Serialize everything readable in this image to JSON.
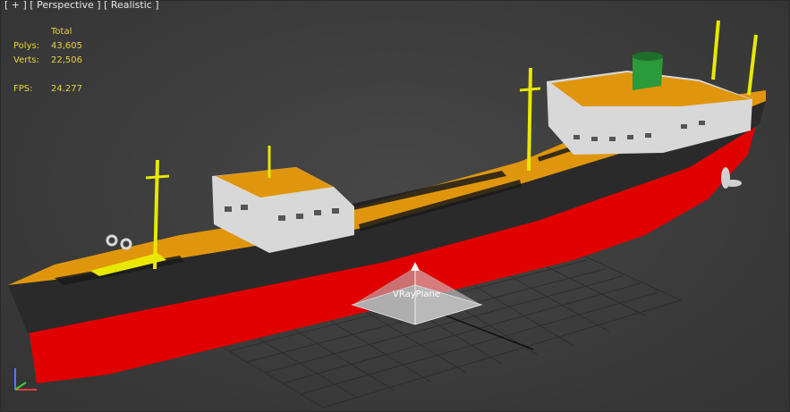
{
  "viewport": {
    "label_plus": "[ + ]",
    "label_view": "[ Perspective ]",
    "label_shading": "[ Realistic ]"
  },
  "stats": {
    "header": "Total",
    "polys_label": "Polys:",
    "polys_value": "43,605",
    "verts_label": "Verts:",
    "verts_value": "22,506",
    "fps_label": "FPS:",
    "fps_value": "24.277"
  },
  "scene": {
    "plane_name": "VRayPlane"
  },
  "colors": {
    "hull_red": "#e00000",
    "hull_black": "#262626",
    "deck_orange": "#e0960c",
    "superstructure_white": "#d8d8d8",
    "mast_yellow": "#e8e800",
    "funnel_green": "#2a9a3a",
    "stats_text": "#e9d23a"
  },
  "icons": [
    "axis-gizmo-icon"
  ]
}
